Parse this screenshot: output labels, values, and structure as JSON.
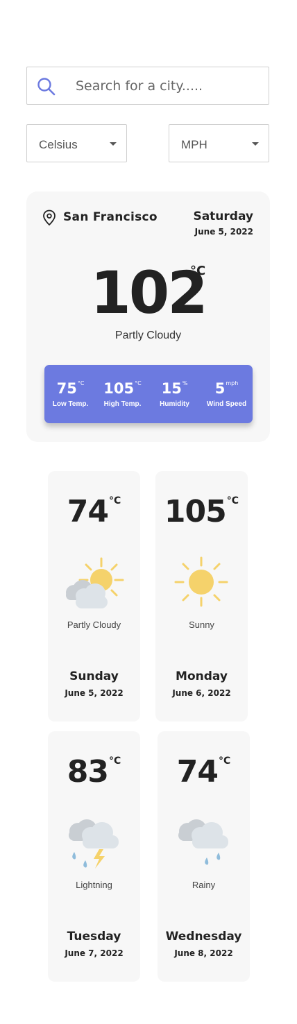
{
  "search": {
    "placeholder": "Search for a city.....",
    "icon": "search-icon"
  },
  "units": {
    "temperature": "Celsius",
    "speed": "MPH"
  },
  "current": {
    "city": "San Francisco",
    "day": "Saturday",
    "date": "June 5, 2022",
    "temp": "102",
    "temp_unit": "°C",
    "condition": "Partly Cloudy",
    "stats": [
      {
        "value": "75",
        "unit": "°C",
        "label": "Low Temp."
      },
      {
        "value": "105",
        "unit": "°C",
        "label": "High Temp."
      },
      {
        "value": "15",
        "unit": "%",
        "label": "Humidity"
      },
      {
        "value": "5",
        "unit": "mph",
        "label": "Wind Speed"
      }
    ]
  },
  "forecast": [
    {
      "temp": "74",
      "unit": "°C",
      "condition": "Partly Cloudy",
      "icon": "partly-cloudy-icon",
      "day": "Sunday",
      "date": "June 5, 2022"
    },
    {
      "temp": "105",
      "unit": "°C",
      "condition": "Sunny",
      "icon": "sun-icon",
      "day": "Monday",
      "date": "June 6, 2022"
    },
    {
      "temp": "83",
      "unit": "°C",
      "condition": "Lightning",
      "icon": "lightning-icon",
      "day": "Tuesday",
      "date": "June 7, 2022"
    },
    {
      "temp": "74",
      "unit": "°C",
      "condition": "Rainy",
      "icon": "rain-icon",
      "day": "Wednesday",
      "date": "June 8, 2022"
    }
  ],
  "colors": {
    "accent": "#6c7ae0",
    "card": "#f7f7f7",
    "sun": "#f5d26b",
    "cloud": "#dde3e8",
    "rain": "#8fbcdb"
  }
}
